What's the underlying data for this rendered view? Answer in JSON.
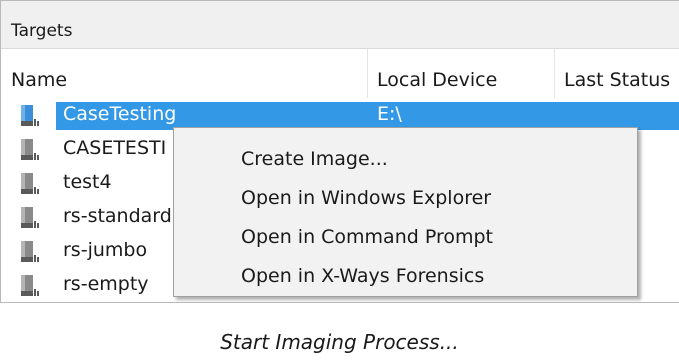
{
  "panel": {
    "title": "Targets"
  },
  "columns": {
    "name": "Name",
    "local_device": "Local Device",
    "last_status": "Last Status"
  },
  "rows": [
    {
      "name": "CaseTesting",
      "device": "E:\\",
      "selected": true
    },
    {
      "name": "CASETESTI",
      "device": "",
      "selected": false
    },
    {
      "name": "test4",
      "device": "",
      "selected": false
    },
    {
      "name": "rs-standard",
      "device": "",
      "selected": false
    },
    {
      "name": "rs-jumbo",
      "device": "",
      "selected": false
    },
    {
      "name": "rs-empty",
      "device": "",
      "selected": false
    }
  ],
  "context_menu": {
    "items": [
      "Create Image...",
      "Open in Windows Explorer",
      "Open in Command Prompt",
      "Open in X-Ways Forensics"
    ]
  },
  "caption": "Start Imaging Process...",
  "icons": {
    "row_icon": "disk-drive-icon"
  },
  "colors": {
    "selection": "#3399e6",
    "selected_disk": "#3a8fd8",
    "disk_gray": "#7f7f7f"
  }
}
